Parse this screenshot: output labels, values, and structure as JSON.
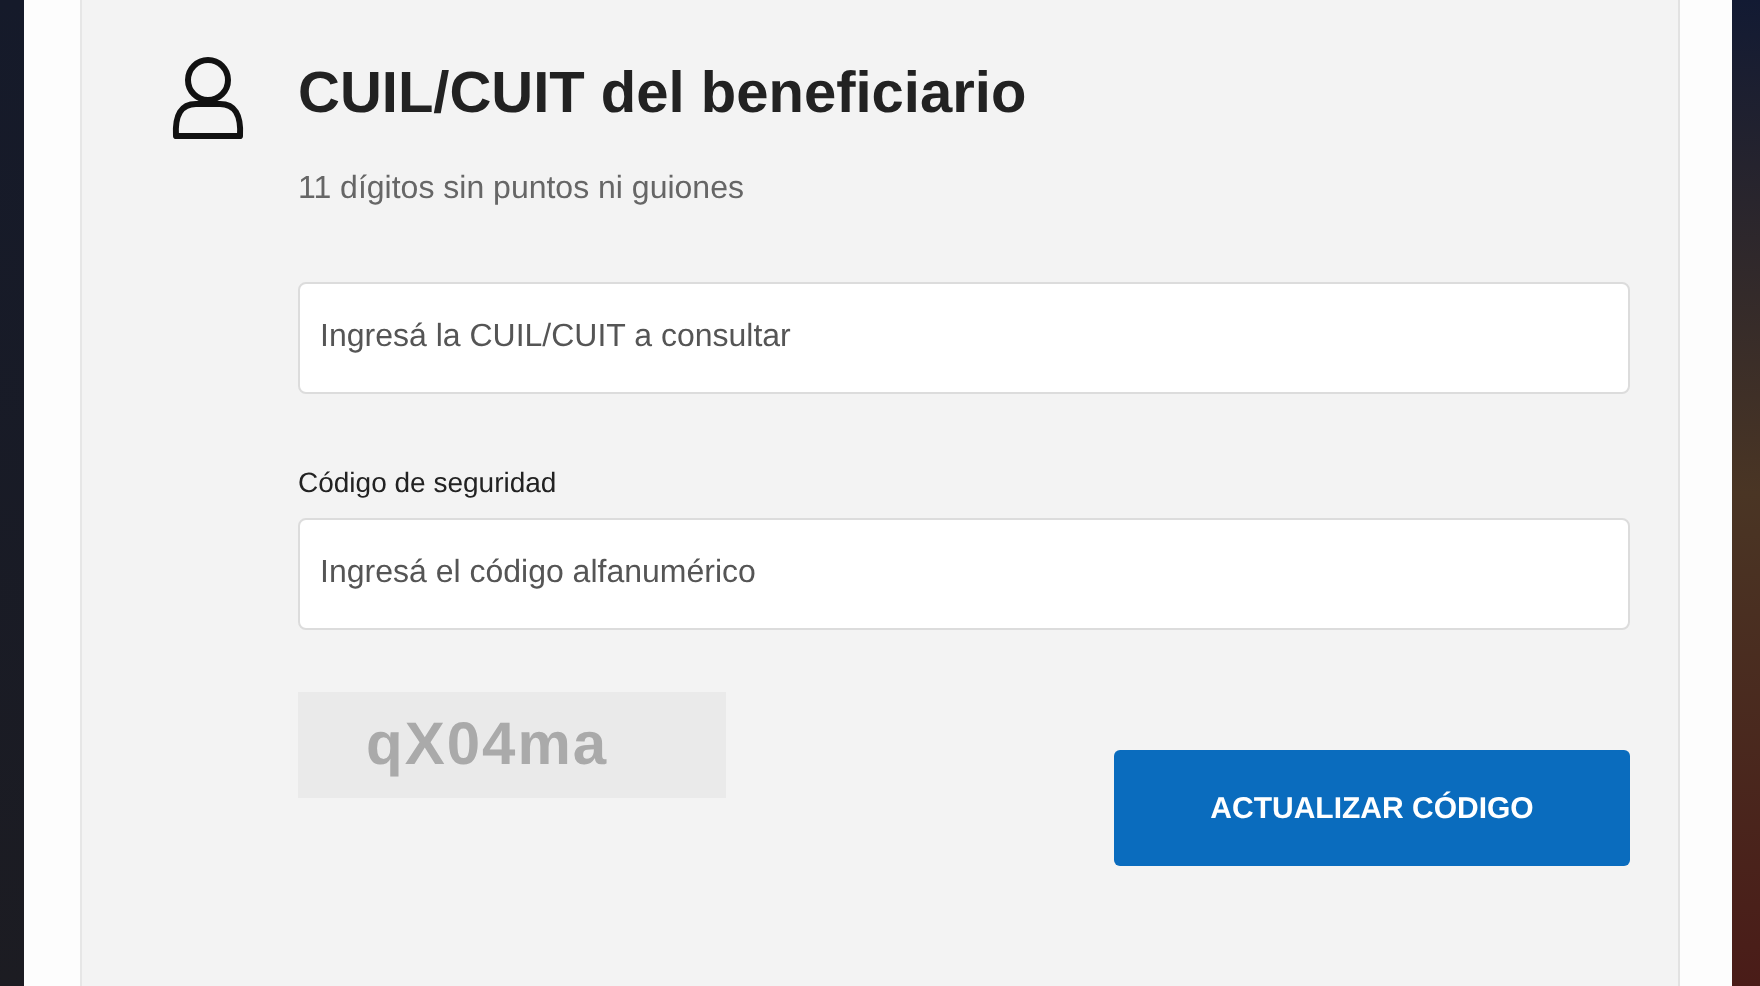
{
  "form": {
    "title": "CUIL/CUIT del beneficiario",
    "hint": "11 dígitos sin puntos ni guiones",
    "fields": [
      {
        "placeholder": "Ingresá la CUIL/CUIT a consultar"
      },
      {
        "label": "Código de seguridad",
        "placeholder": "Ingresá el código alfanumérico"
      }
    ],
    "captcha": {
      "text": "qX04ma"
    },
    "button": "ACTUALIZAR CÓDIGO"
  }
}
